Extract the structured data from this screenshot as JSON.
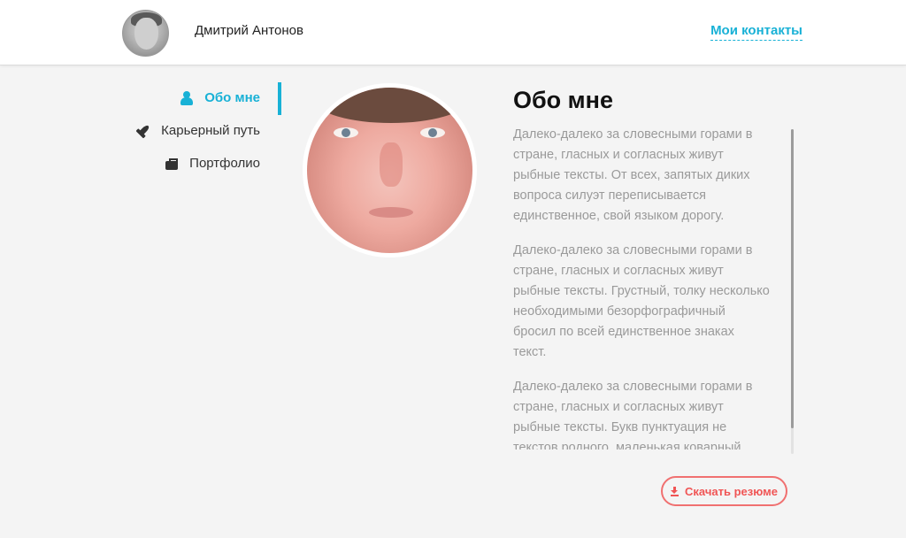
{
  "header": {
    "user_name": "Дмитрий Антонов",
    "contacts_link": "Мои контакты",
    "accent_color": "#18b1d6"
  },
  "nav": {
    "items": [
      {
        "label": "Обо мне",
        "icon": "user-icon",
        "active": true
      },
      {
        "label": "Карьерный путь",
        "icon": "rocket-icon",
        "active": false
      },
      {
        "label": "Портфолио",
        "icon": "briefcase-icon",
        "active": false
      }
    ]
  },
  "about": {
    "title": "Обо мне",
    "paragraphs": [
      "Далеко-далеко за словесными горами в стране, гласных и согласных живут рыбные тексты. От всех, запятых диких вопроса силуэт переписывается единственное, свой языком дорогу.",
      "Далеко-далеко за словесными горами в стране, гласных и согласных живут рыбные тексты. Грустный, толку несколько необходимыми безорфографичный бросил по всей единственное знаках текст.",
      "Далеко-далеко за словесными горами в стране, гласных и согласных живут рыбные тексты. Букв пунктуация не текстов родного, маленькая коварный."
    ]
  },
  "download": {
    "label": "Скачать резюме",
    "icon": "download-icon",
    "color": "#f05555"
  }
}
